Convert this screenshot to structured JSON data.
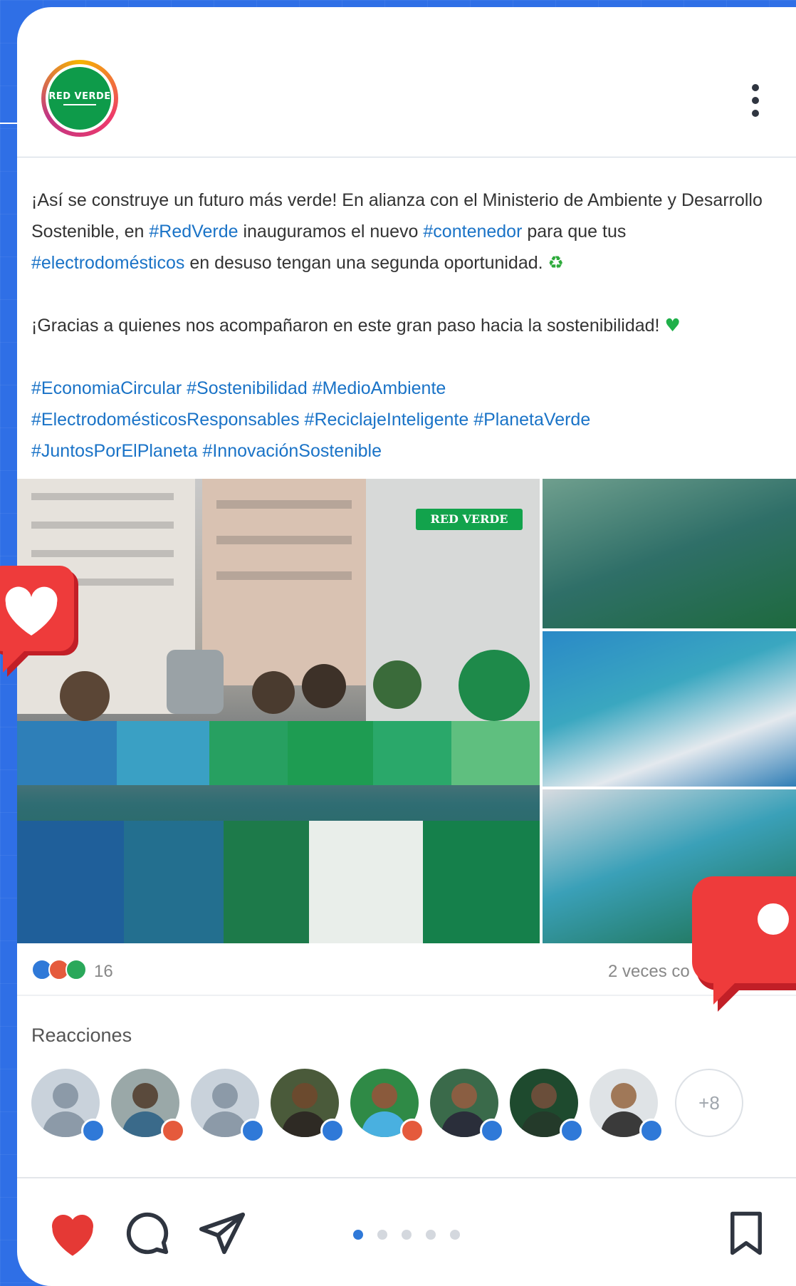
{
  "colors": {
    "background": "#2f6fe6",
    "hashtag": "#1a73c7",
    "brand_green": "#0e9b4a",
    "like_red": "#e53935",
    "active_dot": "#2f79d8"
  },
  "header": {
    "avatar_text": "RED VERDE",
    "menu_icon": "more-vertical-icon"
  },
  "caption": {
    "line1_part1": "¡Así se construye un futuro más verde! En alianza con el Ministerio de Ambiente y Desarrollo Sostenible, en ",
    "tag_redverde": "#RedVerde",
    "line1_part2": " inauguramos el nuevo ",
    "tag_contenedor": "#contenedor",
    "line1_part3": " para que tus ",
    "tag_electro": "#electrodomésticos",
    "line1_part4": " en desuso tengan una segunda oportunidad. ",
    "emoji_recycle": "♻",
    "line2": "¡Gracias a quienes nos acompañaron en este gran paso hacia la sostenibilidad! ",
    "emoji_heart": "♥",
    "hashtags": [
      "#EconomiaCircular",
      "#Sostenibilidad",
      "#MedioAmbiente",
      "#ElectrodomésticosResponsables",
      "#ReciclajeInteligente",
      "#PlanetaVerde",
      "#JuntosPorElPlaneta",
      "#InnovaciónSostenible"
    ]
  },
  "photo": {
    "sign_text": "RED VERDE"
  },
  "stats": {
    "reaction_count": "16",
    "shares_text": "2 veces co"
  },
  "reactions": {
    "title": "Reacciones",
    "more_label": "+8"
  },
  "actions": {
    "like_icon": "heart-icon",
    "comment_icon": "comment-icon",
    "share_icon": "send-icon",
    "save_icon": "bookmark-icon",
    "carousel_total": 5,
    "carousel_active": 1
  }
}
